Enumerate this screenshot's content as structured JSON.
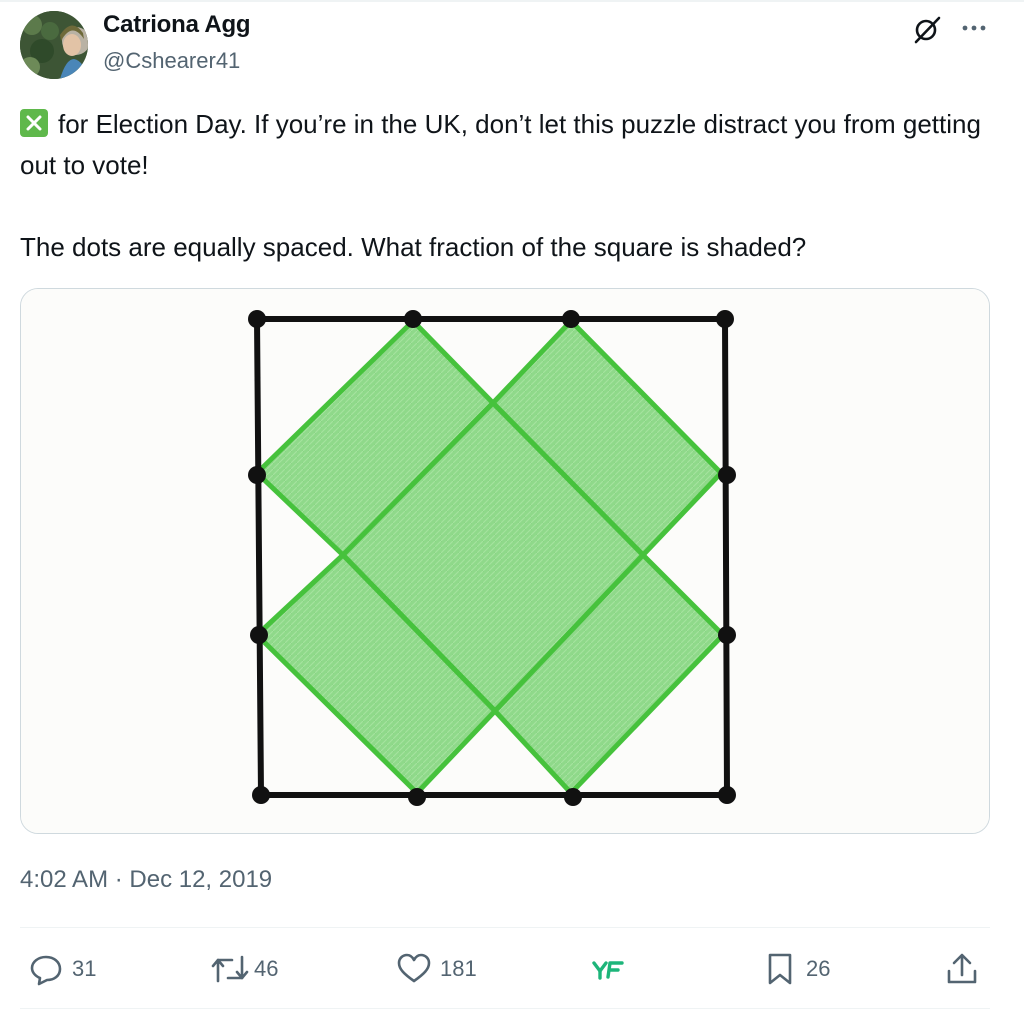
{
  "author": {
    "name": "Catriona Agg",
    "handle": "@Cshearer41"
  },
  "tweet": {
    "emoji": "cross-mark-button",
    "line1": "for Election Day. If you’re in the UK, don’t let this puzzle distract you from getting out to vote!",
    "line2": "The dots are equally spaced. What fraction of the square is shaded?"
  },
  "timestamp": "4:02 AM · Dec 12, 2019",
  "actions": {
    "replies": "31",
    "reposts": "46",
    "likes": "181",
    "bookmarks": "26"
  },
  "icons": [
    "grok-icon",
    "more-icon",
    "reply-icon",
    "repost-icon",
    "like-icon",
    "grok-analytics-icon",
    "bookmark-icon",
    "share-icon"
  ],
  "colors": {
    "text": "#0f1419",
    "secondary": "#536471",
    "shade_green": "#8fd98a",
    "line_green": "#46c23c",
    "grok_green": "#1db57a"
  }
}
